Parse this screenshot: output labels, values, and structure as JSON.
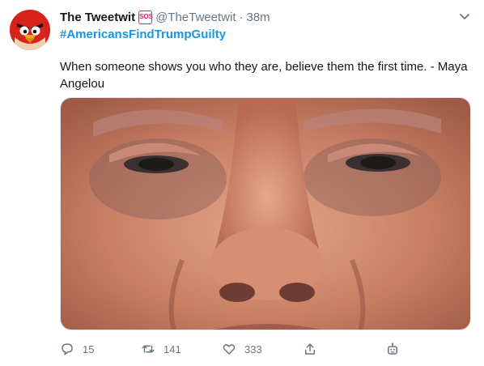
{
  "tweet": {
    "author_name": "The Tweetwit",
    "badge": "SOS",
    "handle": "@TheTweetwit",
    "separator": "·",
    "time": "38m",
    "hashtag": "#AmericansFindTrumpGuilty",
    "text": "When someone shows you who they are, believe them the first time. - Maya Angelou",
    "media_icon": "photo-close-up-face",
    "avatar_icon": "angry-red-bird-icon"
  },
  "actions": {
    "reply_count": "15",
    "retweet_count": "141",
    "like_count": "333",
    "icons": [
      "reply-icon",
      "retweet-icon",
      "like-icon",
      "share-icon",
      "analytics-robot-icon"
    ]
  },
  "colors": {
    "link": "#1b95e0",
    "muted": "#657786",
    "badge": "#e0245e",
    "avatar": "#d8231c"
  }
}
